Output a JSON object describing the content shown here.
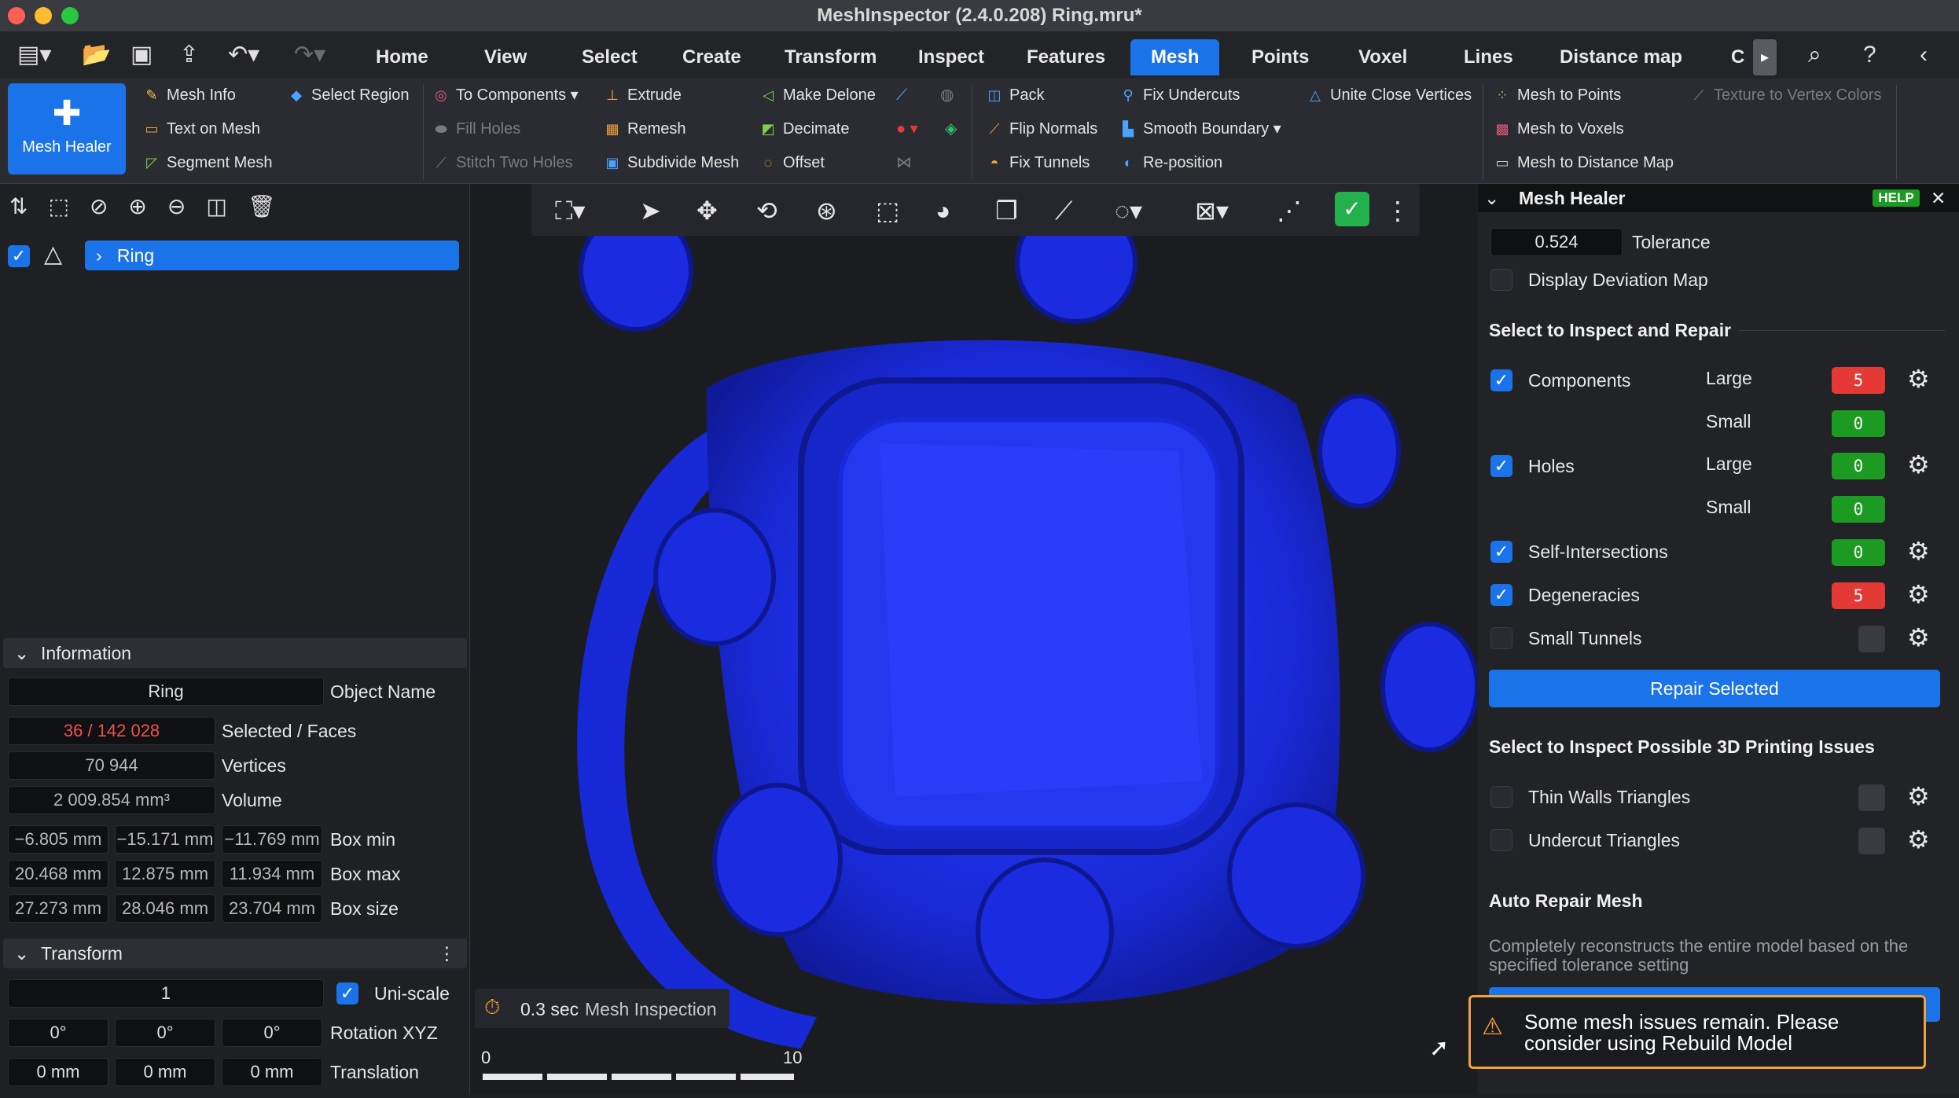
{
  "window": {
    "title": "MeshInspector (2.4.0.208) Ring.mru*"
  },
  "menu": {
    "tabs": [
      "Home",
      "View",
      "Select",
      "Create",
      "Transform",
      "Inspect",
      "Features",
      "Mesh",
      "Points",
      "Voxel",
      "Lines",
      "Distance map",
      "C"
    ],
    "active_tab": "Mesh"
  },
  "ribbon": {
    "main_button": "Mesh Healer",
    "col1": [
      "Mesh Info",
      "Text on Mesh",
      "Segment Mesh"
    ],
    "col2": [
      "Select Region"
    ],
    "col3": [
      "To Components",
      "Fill Holes",
      "Stitch Two Holes"
    ],
    "col4": [
      "Extrude",
      "Remesh",
      "Subdivide Mesh"
    ],
    "col5": [
      "Make Delone",
      "Decimate",
      "Offset"
    ],
    "col6": [
      "Pack",
      "Flip Normals",
      "Fix Tunnels"
    ],
    "col7": [
      "Fix Undercuts",
      "Smooth Boundary",
      "Re-position"
    ],
    "col8": [
      "Unite Close Vertices"
    ],
    "col9": [
      "Mesh to Points",
      "Mesh to Voxels",
      "Mesh to Distance Map"
    ],
    "col10": [
      "Texture to Vertex Colors"
    ]
  },
  "scene_tree": {
    "item": "Ring"
  },
  "information": {
    "header": "Information",
    "object_name_value": "Ring",
    "object_name_label": "Object Name",
    "selected_faces_value": "36 / 142 028",
    "selected_faces_label": "Selected / Faces",
    "vertices_value": "70 944",
    "vertices_label": "Vertices",
    "volume_value": "2 009.854 mm³",
    "volume_label": "Volume",
    "box_min": [
      "−6.805 mm",
      "−15.171 mm",
      "−11.769 mm"
    ],
    "box_min_label": "Box min",
    "box_max": [
      "20.468 mm",
      "12.875 mm",
      "11.934 mm"
    ],
    "box_max_label": "Box max",
    "box_size": [
      "27.273 mm",
      "28.046 mm",
      "23.704 mm"
    ],
    "box_size_label": "Box size"
  },
  "transform": {
    "header": "Transform",
    "scale_value": "1",
    "uniscale_label": "Uni-scale",
    "rotation": [
      "0°",
      "0°",
      "0°"
    ],
    "rotation_label": "Rotation XYZ",
    "translation": [
      "0 mm",
      "0 mm",
      "0 mm"
    ],
    "translation_label": "Translation"
  },
  "viewport": {
    "status_time": "0.3 sec",
    "status_label": "Mesh Inspection",
    "scale_start": "0",
    "scale_end": "10",
    "mesh_color": "#1e2fe6"
  },
  "mesh_healer": {
    "title": "Mesh Healer",
    "help": "HELP",
    "tolerance_value": "0.524",
    "tolerance_label": "Tolerance",
    "deviation_label": "Display Deviation Map",
    "inspect_header": "Select to Inspect and Repair",
    "components_label": "Components",
    "holes_label": "Holes",
    "large_label": "Large",
    "small_label": "Small",
    "components_large": "5",
    "components_small": "0",
    "holes_large": "0",
    "holes_small": "0",
    "self_intersections_label": "Self-Intersections",
    "self_intersections": "0",
    "degeneracies_label": "Degeneracies",
    "degeneracies": "5",
    "small_tunnels_label": "Small Tunnels",
    "repair_button": "Repair Selected",
    "print_header": "Select to Inspect Possible 3D Printing Issues",
    "thin_walls_label": "Thin Walls Triangles",
    "undercut_label": "Undercut Triangles",
    "auto_header": "Auto Repair Mesh",
    "auto_desc": "Completely reconstructs the entire model based on the specified tolerance setting"
  },
  "notification": {
    "text": "Some mesh issues remain. Please consider using Rebuild Model"
  }
}
